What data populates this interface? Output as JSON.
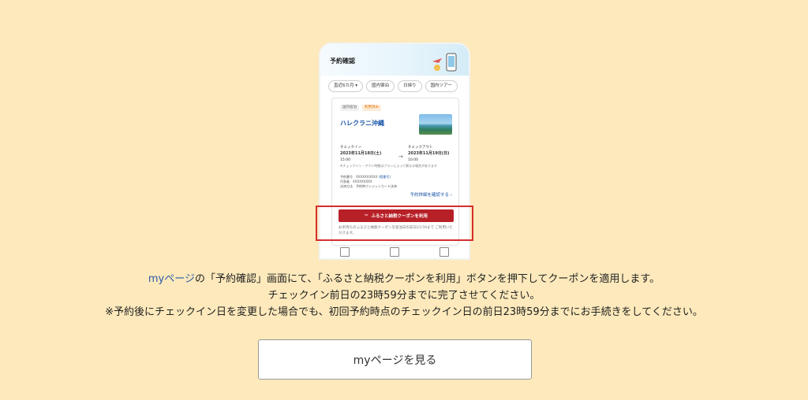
{
  "phone": {
    "title": "予約確認",
    "chips": [
      "直近6カ月 ▾",
      "国内宿泊",
      "日帰り",
      "国内ツアー"
    ],
    "card": {
      "badge_category": "国内宿泊",
      "badge_status": "利用済み",
      "hotel_name": "ハレクラニ沖縄",
      "checkin_label": "チェックイン",
      "checkin_date": "2023年11月18日(土)",
      "checkin_time": "15:00",
      "checkout_label": "チェックアウト",
      "checkout_date": "2023年11月19日(日)",
      "checkout_time": "10:00",
      "note": "※チェックイン・アウト時間はプランによって異なる場合があります",
      "meta_label_1": "予約番号",
      "meta_value_1": "XXXXXXXXXX",
      "meta_link_1": "(宿番号)",
      "meta_label_2": "代表者",
      "meta_value_2": "XXXXXXXXX",
      "meta_label_3": "決済方法",
      "meta_value_3": "予約時クレジットカード決済",
      "detail_link": "予約詳細を確認する ›",
      "coupon_button": "ふるさと納税クーポンを利用",
      "coupon_note": "お手持ちのふるさと納税クーポンを宿泊日の前日23:59まで ご利用いただけます。"
    }
  },
  "message": {
    "line1_link": "myページ",
    "line1_rest": "の「予約確認」画面にて、「ふるさと納税クーポンを利用」ボタンを押下してクーポンを適用します。",
    "line2": "チェックイン前日の23時59分までに完了させてください。",
    "line3": "※予約後にチェックイン日を変更した場合でも、初回予約時点のチェックイン日の前日23時59分までにお手続きをしてください。"
  },
  "cta": {
    "label": "myページを見る"
  },
  "colors": {
    "background": "#fde9bb",
    "coupon_red": "#b82027",
    "highlight_red": "#d32f2f",
    "link_blue": "#2b5aa8"
  }
}
